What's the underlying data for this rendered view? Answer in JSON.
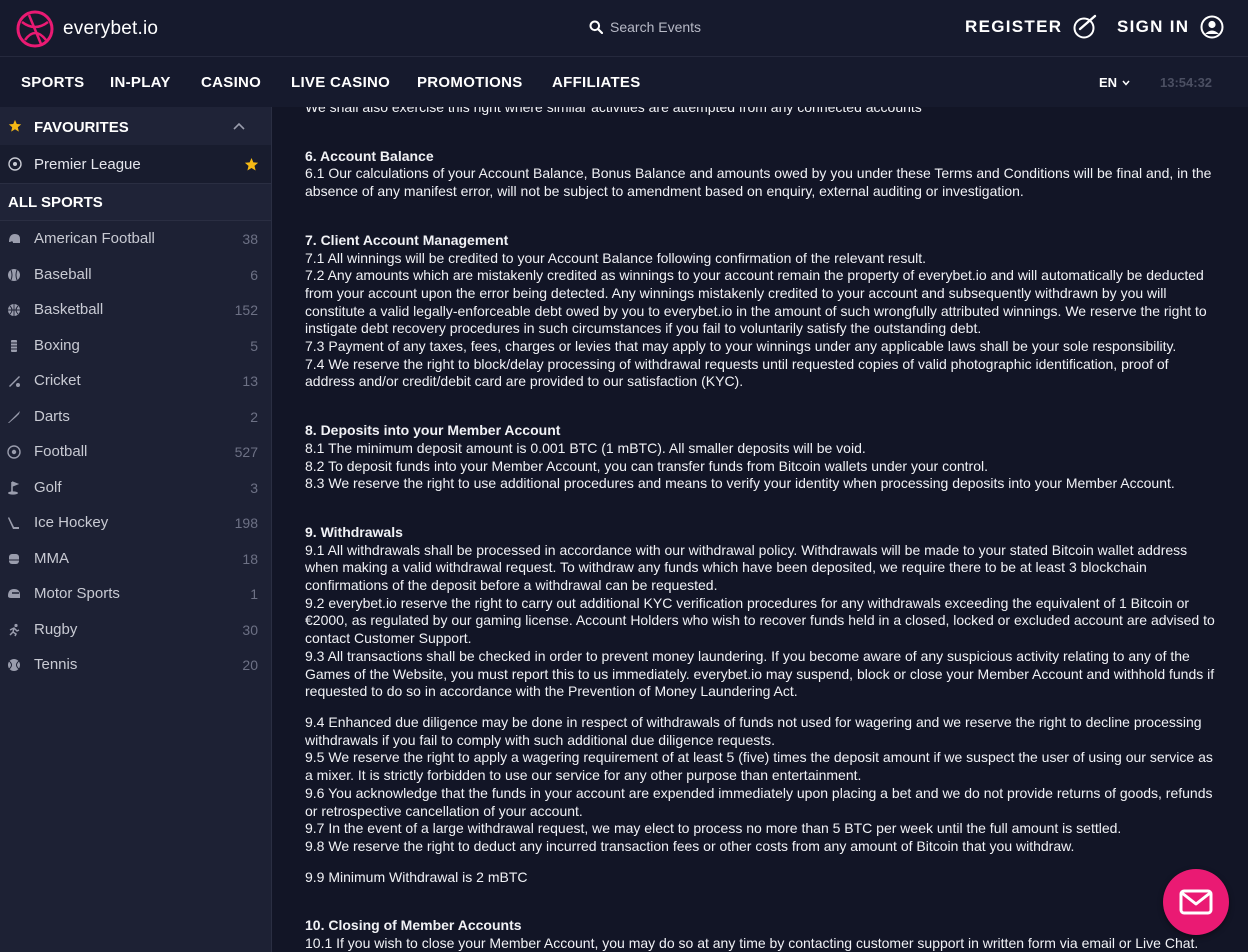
{
  "brand": {
    "name": "everybet.io",
    "accent": "#ea1a73"
  },
  "search": {
    "placeholder": "Search Events",
    "icon": "search-icon"
  },
  "header": {
    "register_label": "REGISTER",
    "signin_label": "SIGN IN"
  },
  "nav": {
    "items": [
      "SPORTS",
      "IN-PLAY",
      "CASINO",
      "LIVE CASINO",
      "PROMOTIONS",
      "AFFILIATES"
    ],
    "language": "EN",
    "clock": "13:54:32"
  },
  "sidebar": {
    "favourites_title": "FAVOURITES",
    "favourites": [
      {
        "label": "Premier League",
        "starred": true
      }
    ],
    "all_sports_title": "ALL SPORTS",
    "sports": [
      {
        "name": "American Football",
        "count": "38",
        "icon": "helmet-icon"
      },
      {
        "name": "Baseball",
        "count": "6",
        "icon": "baseball-icon"
      },
      {
        "name": "Basketball",
        "count": "152",
        "icon": "basketball-icon"
      },
      {
        "name": "Boxing",
        "count": "5",
        "icon": "boxing-icon"
      },
      {
        "name": "Cricket",
        "count": "13",
        "icon": "cricket-icon"
      },
      {
        "name": "Darts",
        "count": "2",
        "icon": "dart-icon"
      },
      {
        "name": "Football",
        "count": "527",
        "icon": "soccer-ball-icon"
      },
      {
        "name": "Golf",
        "count": "3",
        "icon": "golf-icon"
      },
      {
        "name": "Ice Hockey",
        "count": "198",
        "icon": "hockey-stick-icon"
      },
      {
        "name": "MMA",
        "count": "18",
        "icon": "mma-glove-icon"
      },
      {
        "name": "Motor Sports",
        "count": "1",
        "icon": "helmet-racing-icon"
      },
      {
        "name": "Rugby",
        "count": "30",
        "icon": "runner-icon"
      },
      {
        "name": "Tennis",
        "count": "20",
        "icon": "tennis-ball-icon"
      }
    ]
  },
  "content": {
    "top_line": "We shall also exercise this right where similar activities are attempted from any connected accounts",
    "sections": [
      {
        "title": "6. Account Balance",
        "paragraphs": [
          "6.1 Our calculations of your Account Balance, Bonus Balance and amounts owed by you under these Terms and Conditions will be final and, in the absence of any manifest error, will not be subject to amendment based on enquiry, external auditing or investigation."
        ]
      },
      {
        "title": "7. Client Account Management",
        "paragraphs": [
          "7.1 All winnings will be credited to your Account Balance following confirmation of the relevant result.",
          "7.2 Any amounts which are mistakenly credited as winnings to your account remain the property of everybet.io and will automatically be deducted from your account upon the error being detected. Any winnings mistakenly credited to your account and subsequently withdrawn by you will constitute a valid legally-enforceable debt owed by you to everybet.io in the amount of such wrongfully attributed winnings. We reserve the right to instigate debt recovery procedures in such circumstances if you fail to voluntarily satisfy the outstanding debt.",
          "7.3 Payment of any taxes, fees, charges or levies that may apply to your winnings under any applicable laws shall be your sole responsibility.",
          "7.4 We reserve the right to block/delay processing of withdrawal requests until requested copies of valid photographic identification, proof of address and/or credit/debit card are provided to our satisfaction (KYC)."
        ]
      },
      {
        "title": "8. Deposits into your Member Account",
        "paragraphs": [
          "8.1 The minimum deposit amount is 0.001 BTC (1 mBTC). All smaller deposits will be void.",
          "8.2 To deposit funds into your Member Account, you can transfer funds from Bitcoin wallets under your control.",
          "8.3 We reserve the right to use additional procedures and means to verify your identity when processing deposits into your Member Account."
        ]
      },
      {
        "title": "9. Withdrawals",
        "paragraphs": [
          "9.1 All withdrawals shall be processed in accordance with our withdrawal policy. Withdrawals will be made to your stated Bitcoin wallet address when making a valid withdrawal request. To withdraw any funds which have been deposited, we require there to be at least 3 blockchain confirmations of the deposit before a withdrawal can be requested.",
          "9.2 everybet.io reserve the right to carry out additional KYC verification procedures for any withdrawals exceeding the equivalent of 1 Bitcoin or €2000, as regulated by our gaming license. Account Holders who wish to recover funds held in a closed, locked or excluded account are advised to contact Customer Support.",
          "9.3 All transactions shall be checked in order to prevent money laundering. If you become aware of any suspicious activity relating to any of the Games of the Website, you must report this to us immediately. everybet.io may suspend, block or close your Member Account and withhold funds if requested to do so in accordance with the Prevention of Money Laundering Act.",
          "9.4 Enhanced due diligence may be done in respect of withdrawals of funds not used for wagering and we reserve the right to decline processing withdrawals if you fail to comply with such additional due diligence requests.",
          "9.5 We reserve the right to apply a wagering requirement of at least 5 (five) times the deposit amount if we suspect the user of using our service as a mixer. It is strictly forbidden to use our service for any other purpose than entertainment.",
          "9.6 You acknowledge that the funds in your account are expended immediately upon placing a bet and we do not provide returns of goods, refunds or retrospective cancellation of your account.",
          "9.7 In the event of a large withdrawal request, we may elect to process no more than 5 BTC per week until the full amount is settled.",
          "9.8 We reserve the right to deduct any incurred transaction fees or other costs from any amount of Bitcoin that you withdraw.",
          "9.9 Minimum Withdrawal is 2 mBTC"
        ]
      },
      {
        "title": "10. Closing of Member Accounts",
        "paragraphs": [
          "10.1 If you wish to close your Member Account, you may do so at any time by contacting customer support in written form via email or Live Chat. The"
        ]
      }
    ]
  },
  "chat": {
    "icon": "envelope-icon"
  }
}
